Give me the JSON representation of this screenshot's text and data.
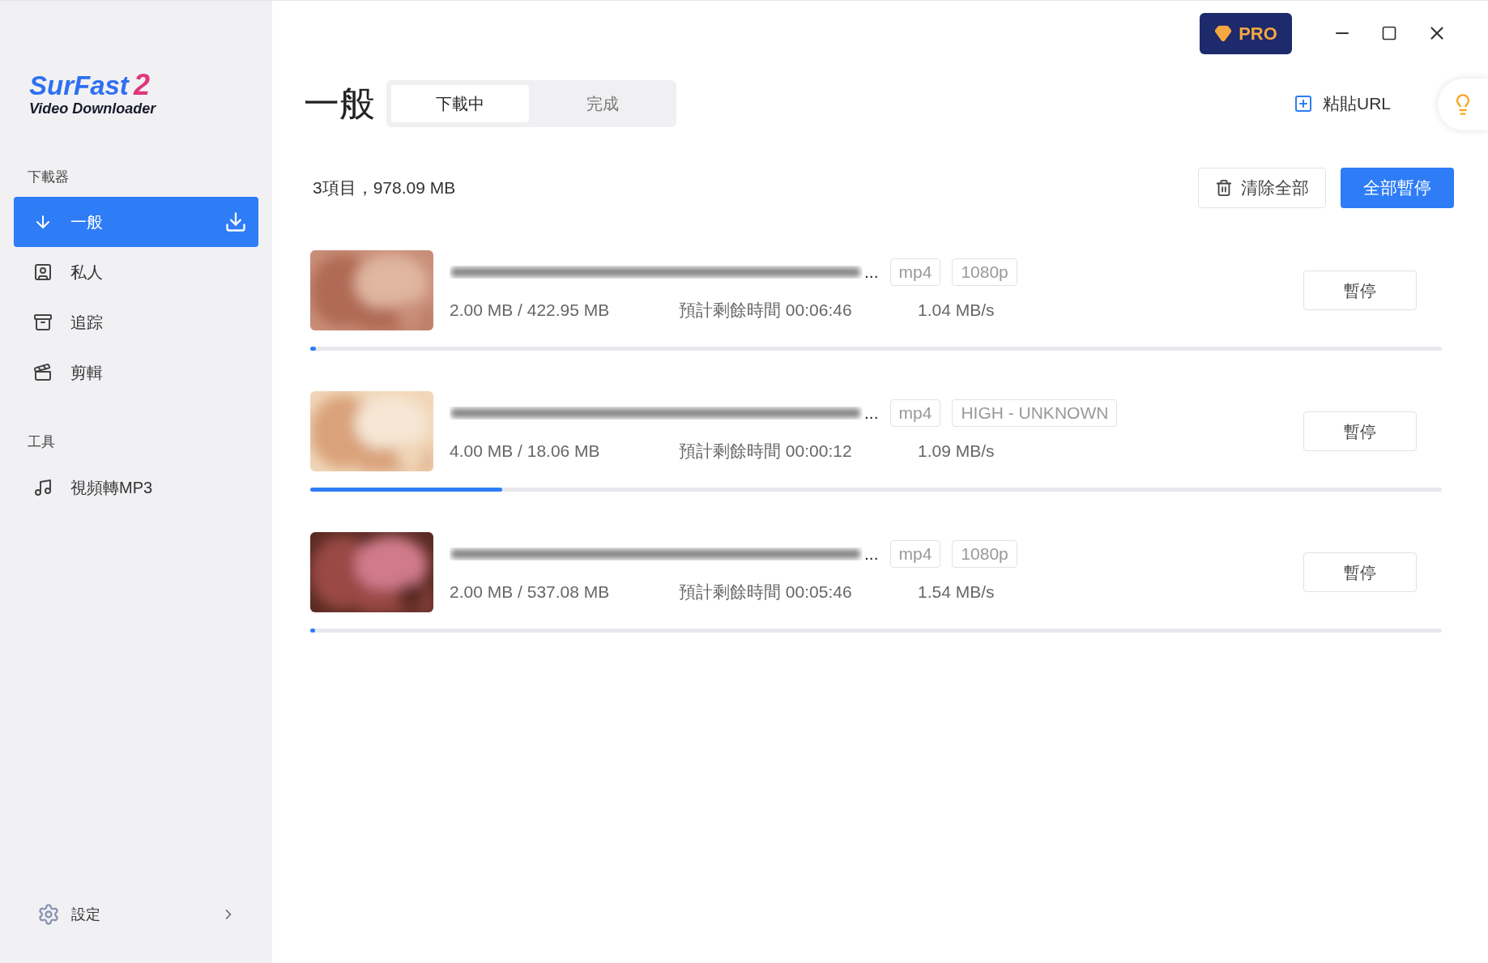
{
  "logo": {
    "name": "SurFast",
    "version": "2",
    "subtitle": "Video Downloader"
  },
  "sidebar": {
    "sections": [
      {
        "heading": "下載器",
        "items": [
          {
            "label": "一般",
            "selected": true
          },
          {
            "label": "私人",
            "selected": false
          },
          {
            "label": "追踪",
            "selected": false
          },
          {
            "label": "剪輯",
            "selected": false
          }
        ]
      },
      {
        "heading": "工具",
        "items": [
          {
            "label": "視頻轉MP3",
            "selected": false
          }
        ]
      }
    ],
    "settings": "設定"
  },
  "header": {
    "title": "一般",
    "tabs": [
      {
        "label": "下載中",
        "selected": true
      },
      {
        "label": "完成",
        "selected": false
      }
    ],
    "pro": "PRO",
    "paste_url": "粘貼URL"
  },
  "summary": "3項目，978.09 MB",
  "clear_all": "清除全部",
  "pause_all": "全部暫停",
  "downloads": [
    {
      "ellipsis": "...",
      "format": "mp4",
      "quality": "1080p",
      "size": "2.00 MB / 422.95 MB",
      "eta": "預計剩餘時間 00:06:46",
      "speed": "1.04 MB/s",
      "level": 0.005,
      "button": "暫停"
    },
    {
      "ellipsis": "...",
      "format": "mp4",
      "quality": "HIGH - UNKNOWN",
      "size": "4.00 MB / 18.06 MB",
      "eta": "預計剩餘時間 00:00:12",
      "speed": "1.09 MB/s",
      "level": 0.17,
      "button": "暫停"
    },
    {
      "ellipsis": "...",
      "format": "mp4",
      "quality": "1080p",
      "size": "2.00 MB / 537.08 MB",
      "eta": "預計剩餘時間 00:05:46",
      "speed": "1.54 MB/s",
      "level": 0.004,
      "button": "暫停"
    }
  ]
}
